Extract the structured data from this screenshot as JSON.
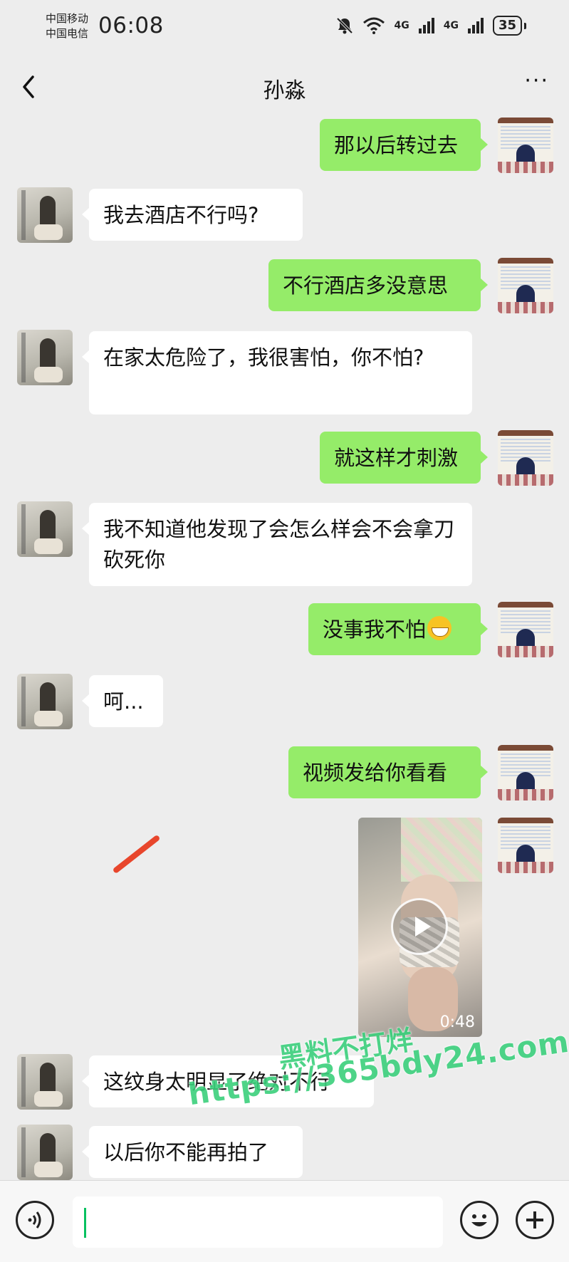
{
  "status_bar": {
    "carrier1": "中国移动",
    "carrier2": "中国电信",
    "time": "06:08",
    "net1": "4G",
    "net2": "4G",
    "battery": "35",
    "icons": [
      "mute-bell-icon",
      "wifi-icon",
      "signal-icon",
      "signal-icon",
      "battery-icon"
    ]
  },
  "header": {
    "title": "孙淼",
    "back_icon": "chevron-left-icon",
    "more_label": "···"
  },
  "messages": [
    {
      "side": "right",
      "text": "那以后转过去"
    },
    {
      "side": "left",
      "text": "我去酒店不行吗?"
    },
    {
      "side": "right",
      "text": "不行酒店多没意思"
    },
    {
      "side": "left",
      "text": "在家太危险了，我很害怕，你不怕?"
    },
    {
      "side": "right",
      "text": "就这样才刺激"
    },
    {
      "side": "left",
      "text": "我不知道他发现了会怎么样会不会拿刀砍死你"
    },
    {
      "side": "right",
      "text": "没事我不怕",
      "emoji": "grinning-face-icon"
    },
    {
      "side": "left",
      "text": "呵..."
    },
    {
      "side": "right",
      "text": "视频发给你看看"
    },
    {
      "side": "right",
      "type": "video",
      "duration": "0:48"
    },
    {
      "side": "left",
      "text": "这纹身太明显了绝对不行"
    },
    {
      "side": "left",
      "text": "以后你不能再拍了"
    }
  ],
  "watermark": {
    "line1": "黑料不打烊",
    "line2": "https://365bdy24.com"
  },
  "colors": {
    "background": "#ededed",
    "bubble_sent": "#95ec69",
    "bubble_received": "#ffffff",
    "watermark": "#3bd07c",
    "annotation": "#e8462c"
  },
  "input_bar": {
    "voice_icon": "voice-icon",
    "emoji_icon": "emoji-icon",
    "plus_icon": "plus-icon",
    "value": ""
  }
}
